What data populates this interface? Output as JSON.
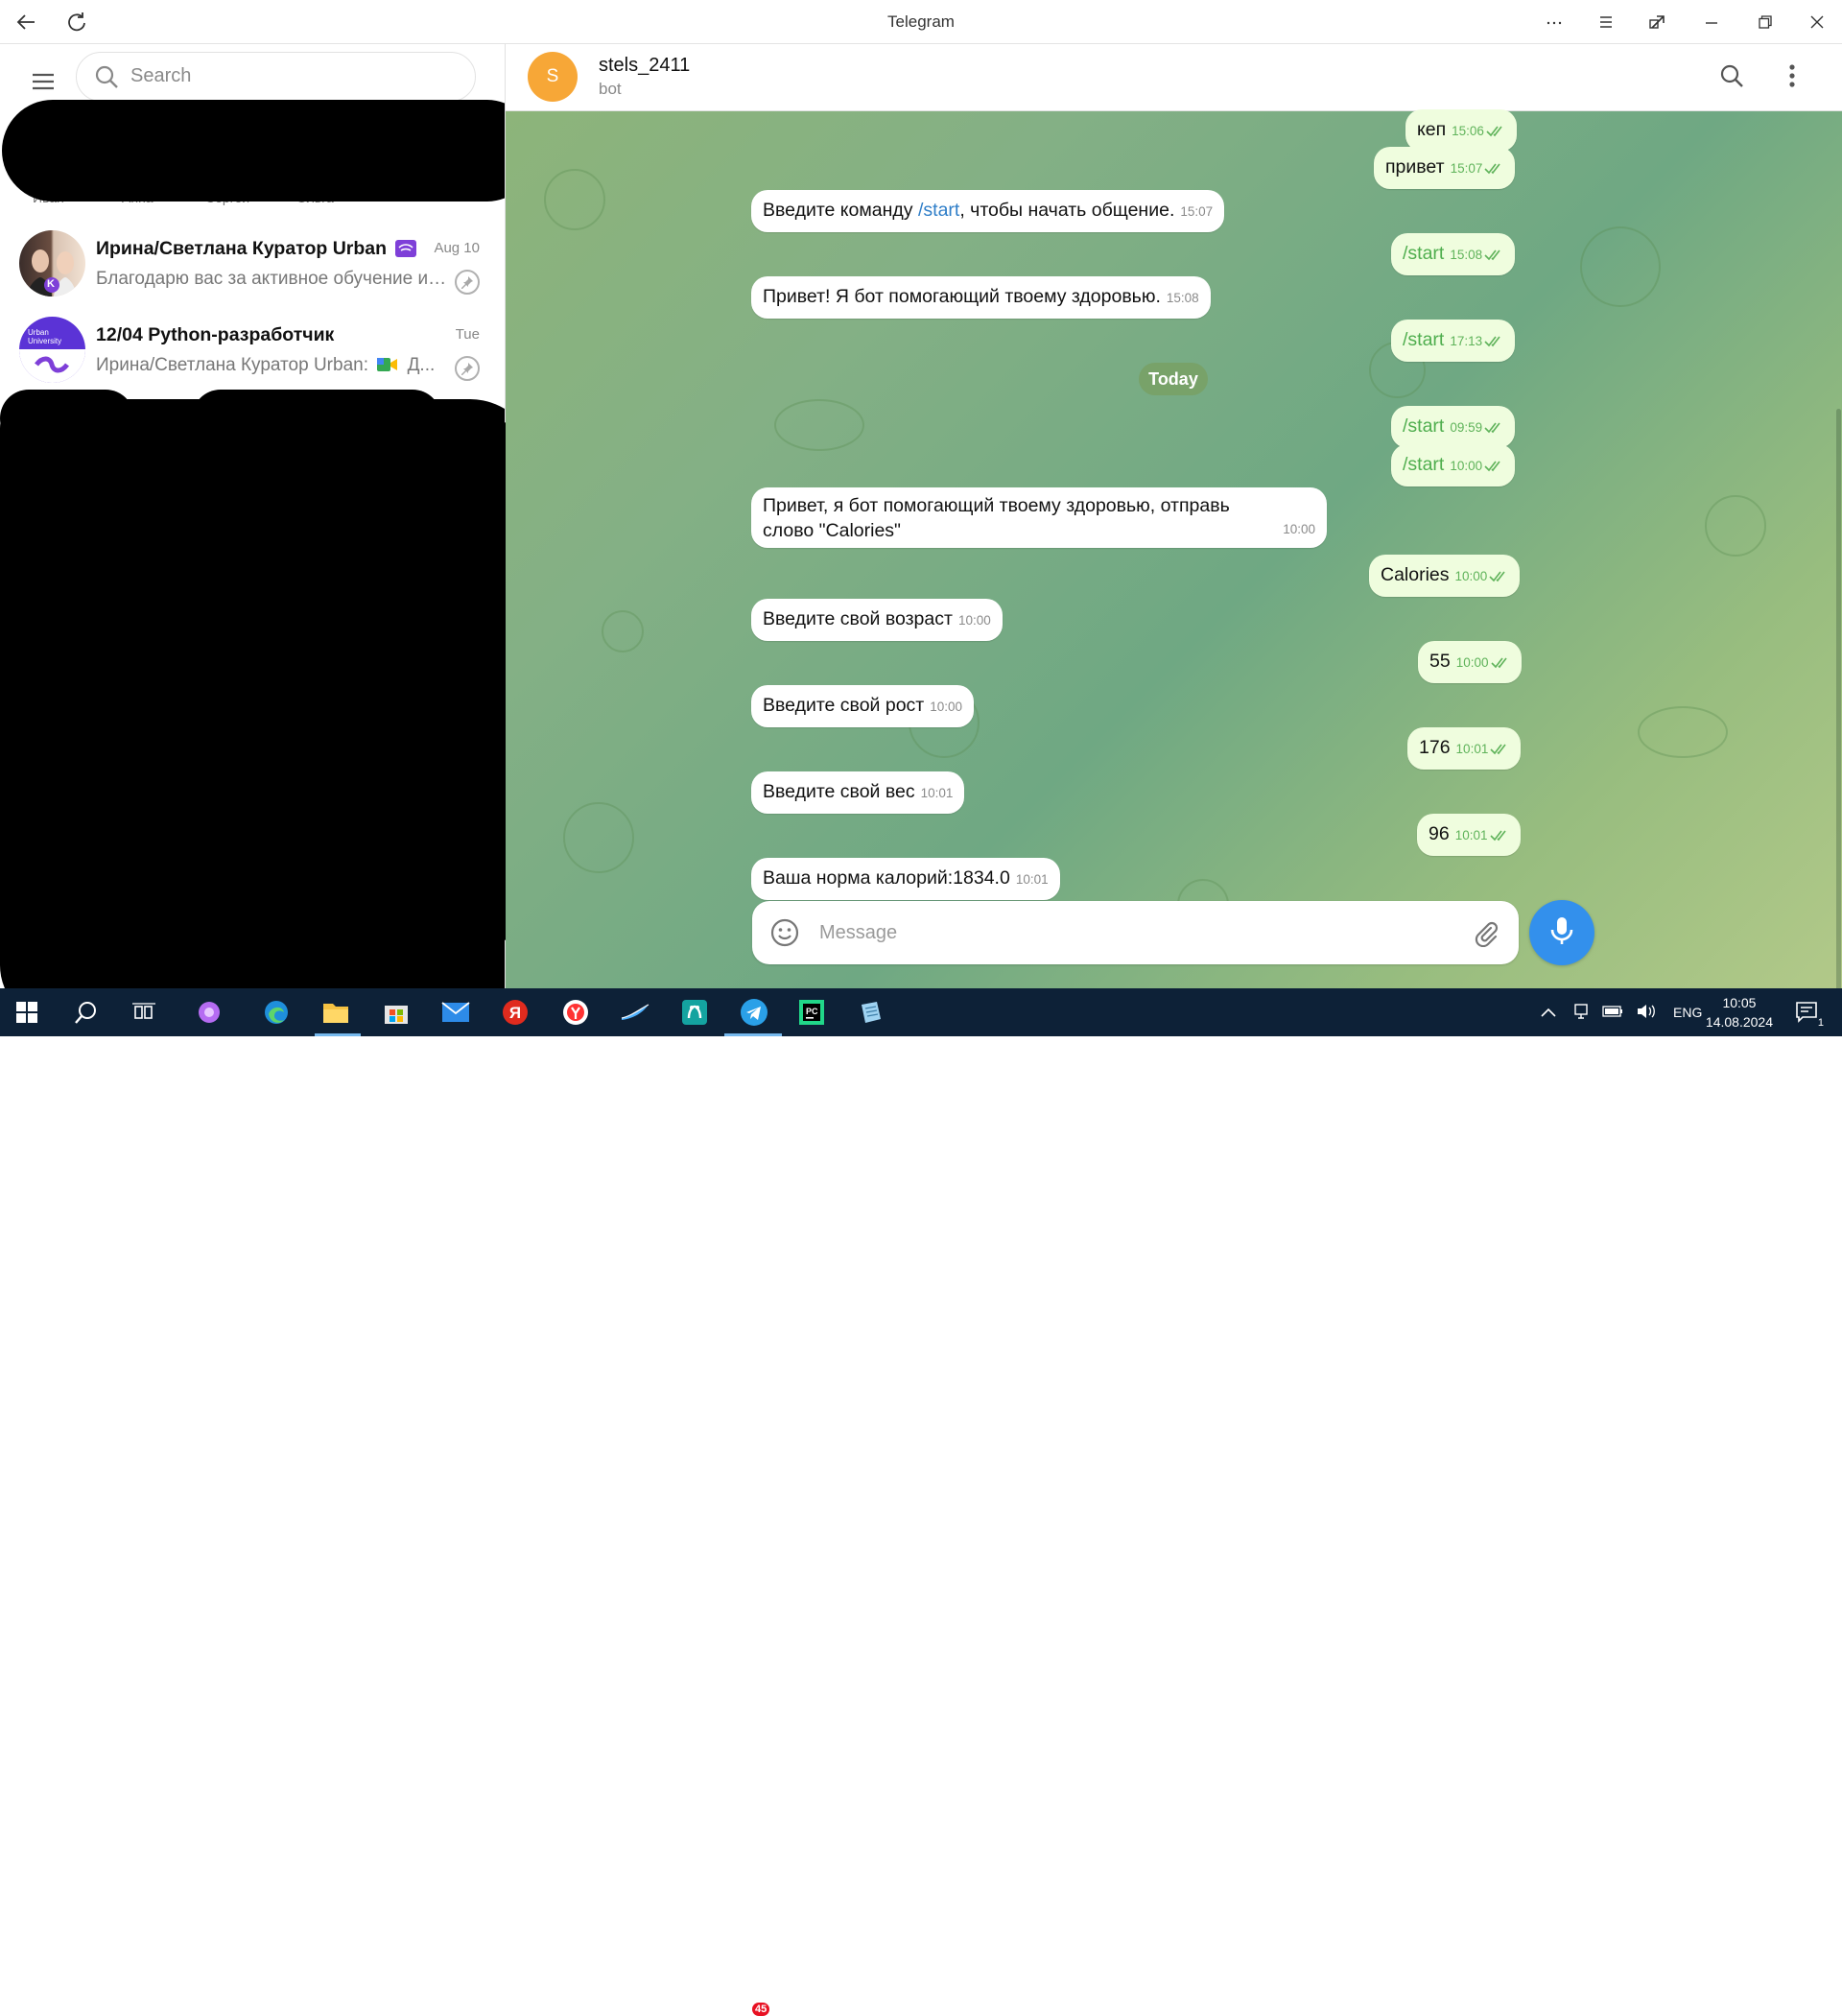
{
  "window": {
    "title": "Telegram"
  },
  "sidebar": {
    "search": {
      "placeholder": "Search"
    },
    "hidden_row_fragments": [
      "Иван",
      "Анна",
      "Сергей",
      "Ольга"
    ],
    "chats": [
      {
        "name": "Ирина/Светлана Куратор Urban",
        "date": "Aug 10",
        "preview": "Благодарю вас за активное обучение и участие в потоке!",
        "avatar_badge": "K"
      },
      {
        "name": "12/04 Python-разработчик",
        "date": "Tue",
        "preview_sender": "Ирина/Светлана Куратор Urban:",
        "preview": "Д...",
        "avatar_text": "Urban University"
      }
    ]
  },
  "chat": {
    "name": "stels_2411",
    "status": "bot",
    "avatar_letter": "S",
    "date_separator": "Today",
    "messages": [
      {
        "dir": "out",
        "text": "кеп",
        "time": "15:06"
      },
      {
        "dir": "out",
        "text": "привет",
        "time": "15:07"
      },
      {
        "dir": "in",
        "pre": "Введите команду ",
        "cmd": "/start",
        "post": ", чтобы начать общение.",
        "time": "15:07"
      },
      {
        "dir": "out",
        "text": "/start",
        "time": "15:08"
      },
      {
        "dir": "in",
        "text": "Привет! Я бот помогающий твоему здоровью.",
        "time": "15:08"
      },
      {
        "dir": "out",
        "text": "/start",
        "time": "17:13"
      },
      {
        "dir": "out",
        "text": "/start",
        "time": "09:59"
      },
      {
        "dir": "out",
        "text": "/start",
        "time": "10:00"
      },
      {
        "dir": "in",
        "text": "Привет, я бот помогающий твоему здоровью, отправь слово \"Calories\"",
        "time": "10:00"
      },
      {
        "dir": "out",
        "text": "Calories",
        "time": "10:00"
      },
      {
        "dir": "in",
        "text": "Введите свой возраст",
        "time": "10:00"
      },
      {
        "dir": "out",
        "text": "55",
        "time": "10:00"
      },
      {
        "dir": "in",
        "text": "Введите свой рост",
        "time": "10:00"
      },
      {
        "dir": "out",
        "text": "176",
        "time": "10:01"
      },
      {
        "dir": "in",
        "text": "Введите свой вес",
        "time": "10:01"
      },
      {
        "dir": "out",
        "text": "96",
        "time": "10:01"
      },
      {
        "dir": "in",
        "text": "Ваша норма калорий:1834.0",
        "time": "10:01"
      }
    ],
    "composer": {
      "placeholder": "Message"
    }
  },
  "taskbar": {
    "apps": [
      "start",
      "search",
      "task-view",
      "cortana",
      "edge",
      "file-explorer",
      "store",
      "mail",
      "yandex-browser-ya",
      "yandex-browser",
      "telegram-web",
      "pycharm-old",
      "telegram",
      "pycharm",
      "notepad"
    ],
    "telegram_badge": "45",
    "language": "ENG",
    "time": "10:05",
    "date": "14.08.2024",
    "notifications": "1"
  },
  "colors": {
    "accent": "#3390ec",
    "outgoing_bubble": "#effdde",
    "avatar": "#f7a737"
  }
}
